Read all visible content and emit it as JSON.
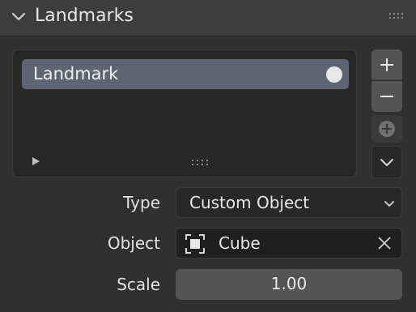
{
  "panel": {
    "title": "Landmarks"
  },
  "list": {
    "items": [
      {
        "label": "Landmark"
      }
    ]
  },
  "side_buttons": {
    "add": "+",
    "remove": "−"
  },
  "properties": {
    "type": {
      "label": "Type",
      "value": "Custom Object"
    },
    "object": {
      "label": "Object",
      "value": "Cube"
    },
    "scale": {
      "label": "Scale",
      "value": "1.00"
    }
  },
  "colors": {
    "panel_bg": "#303030",
    "header_bg": "#3d3d3d",
    "selected_item": "#5d6473",
    "button": "#545454"
  },
  "icons": {
    "collapse": "chevron-down-icon",
    "drag": "grip-dots-icon",
    "item_state": "circle-dot-icon",
    "expand": "play-triangle-icon",
    "add": "plus-icon",
    "remove": "minus-icon",
    "add_point": "circle-plus-icon",
    "menu": "chevron-down-icon",
    "dropdown": "chevron-down-icon",
    "object": "cube-object-icon",
    "clear": "close-icon"
  }
}
